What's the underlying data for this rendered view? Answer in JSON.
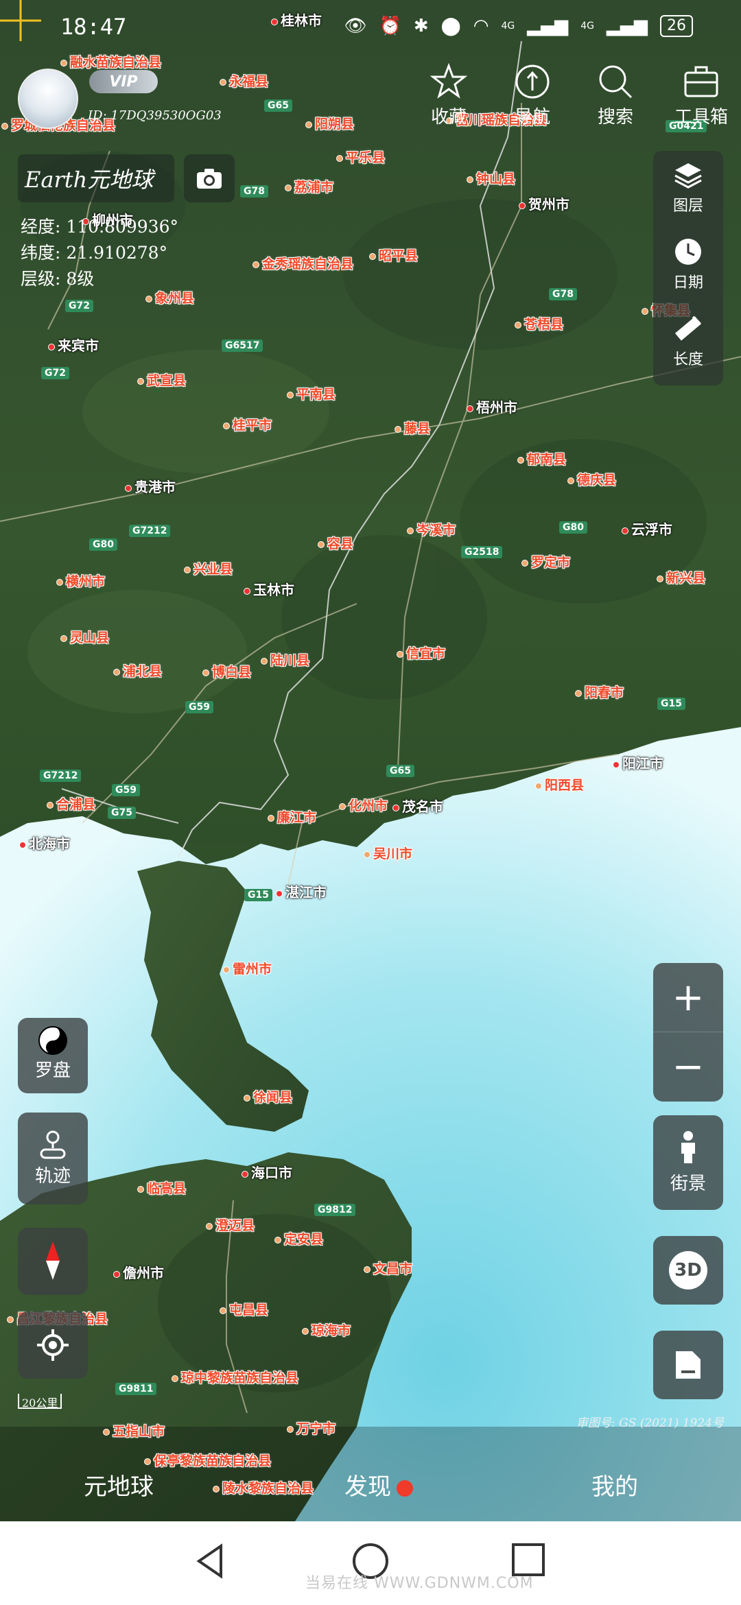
{
  "status_bar": {
    "time": "18:47",
    "network_1": "4G",
    "network_2": "4G",
    "battery": "26"
  },
  "user": {
    "vip_label": "VIP",
    "id": "ID: 17DQ39530OG03"
  },
  "brand": {
    "title": "Earth元地球"
  },
  "coordinates": {
    "longitude": "经度: 110.809936°",
    "latitude": "纬度: 21.910278°",
    "level": "层级: 8级"
  },
  "top_actions": [
    {
      "label": "收藏",
      "icon": "star-icon"
    },
    {
      "label": "导航",
      "icon": "navigation-icon"
    },
    {
      "label": "搜索",
      "icon": "search-icon"
    },
    {
      "label": "工具箱",
      "icon": "toolbox-icon"
    }
  ],
  "tool_panel": [
    {
      "label": "图层",
      "icon": "layers-icon"
    },
    {
      "label": "日期",
      "icon": "clock-icon"
    },
    {
      "label": "长度",
      "icon": "ruler-icon"
    }
  ],
  "left_controls": {
    "compass": "罗盘",
    "track": "轨迹"
  },
  "right_controls": {
    "zoom_in": "+",
    "zoom_out": "−",
    "street_view": "街景",
    "three_d": "3D"
  },
  "scale_bar": "20公里",
  "map_approval": "审图号: GS (2021) 1924号",
  "places": [
    {
      "name": "融水苗族自治县",
      "type": "county"
    },
    {
      "name": "罗城仫佬族自治县",
      "type": "county"
    },
    {
      "name": "桂林市",
      "type": "city"
    },
    {
      "name": "永福县",
      "type": "county"
    },
    {
      "name": "阳朔县",
      "type": "county"
    },
    {
      "name": "富川瑶族自治县",
      "type": "county"
    },
    {
      "name": "平乐县",
      "type": "county"
    },
    {
      "name": "荔浦市",
      "type": "county"
    },
    {
      "name": "钟山县",
      "type": "county"
    },
    {
      "name": "贺州市",
      "type": "city"
    },
    {
      "name": "柳州市",
      "type": "city"
    },
    {
      "name": "金秀瑶族自治县",
      "type": "county"
    },
    {
      "name": "昭平县",
      "type": "county"
    },
    {
      "name": "象州县",
      "type": "county"
    },
    {
      "name": "来宾市",
      "type": "city"
    },
    {
      "name": "苍梧县",
      "type": "county"
    },
    {
      "name": "怀集县",
      "type": "county"
    },
    {
      "name": "武宣县",
      "type": "county"
    },
    {
      "name": "平南县",
      "type": "county"
    },
    {
      "name": "桂平市",
      "type": "county"
    },
    {
      "name": "梧州市",
      "type": "city"
    },
    {
      "name": "藤县",
      "type": "county"
    },
    {
      "name": "贵港市",
      "type": "city"
    },
    {
      "name": "郁南县",
      "type": "county"
    },
    {
      "name": "德庆县",
      "type": "county"
    },
    {
      "name": "岑溪市",
      "type": "county"
    },
    {
      "name": "云浮市",
      "type": "city"
    },
    {
      "name": "横州市",
      "type": "county"
    },
    {
      "name": "兴业县",
      "type": "county"
    },
    {
      "name": "容县",
      "type": "county"
    },
    {
      "name": "罗定市",
      "type": "county"
    },
    {
      "name": "新兴县",
      "type": "county"
    },
    {
      "name": "玉林市",
      "type": "city"
    },
    {
      "name": "灵山县",
      "type": "county"
    },
    {
      "name": "信宜市",
      "type": "county"
    },
    {
      "name": "浦北县",
      "type": "county"
    },
    {
      "name": "博白县",
      "type": "county"
    },
    {
      "name": "陆川县",
      "type": "county"
    },
    {
      "name": "阳春市",
      "type": "county"
    },
    {
      "name": "阳江市",
      "type": "city"
    },
    {
      "name": "合浦县",
      "type": "county"
    },
    {
      "name": "廉江市",
      "type": "county"
    },
    {
      "name": "化州市",
      "type": "county"
    },
    {
      "name": "茂名市",
      "type": "city"
    },
    {
      "name": "阳西县",
      "type": "county"
    },
    {
      "name": "北海市",
      "type": "city"
    },
    {
      "name": "吴川市",
      "type": "county"
    },
    {
      "name": "湛江市",
      "type": "city"
    },
    {
      "name": "雷州市",
      "type": "county"
    },
    {
      "name": "徐闻县",
      "type": "county"
    },
    {
      "name": "海口市",
      "type": "city"
    },
    {
      "name": "临高县",
      "type": "county"
    },
    {
      "name": "澄迈县",
      "type": "county"
    },
    {
      "name": "定安县",
      "type": "county"
    },
    {
      "name": "儋州市",
      "type": "city"
    },
    {
      "name": "文昌市",
      "type": "county"
    },
    {
      "name": "屯昌县",
      "type": "county"
    },
    {
      "name": "琼海市",
      "type": "county"
    },
    {
      "name": "昌江黎族自治县",
      "type": "county"
    },
    {
      "name": "琼中黎族苗族自治县",
      "type": "county"
    },
    {
      "name": "五指山市",
      "type": "county"
    },
    {
      "name": "万宁市",
      "type": "county"
    },
    {
      "name": "保亭黎族苗族自治县",
      "type": "county"
    },
    {
      "name": "陵水黎族自治县",
      "type": "county"
    }
  ],
  "roads": [
    "G65",
    "G0421",
    "G78",
    "G72",
    "G6517",
    "G7212",
    "G80",
    "G2518",
    "G59",
    "G15",
    "G75",
    "G9812",
    "G9811"
  ],
  "bottom_tabs": [
    {
      "label": "元地球"
    },
    {
      "label": "发现",
      "has_badge": true
    },
    {
      "label": "我的"
    }
  ],
  "nav_bar": {
    "watermark": "当易在线 WWW.GDNWM.COM"
  },
  "colors": {
    "place_label": "#f04a2a",
    "road_badge": "#2f8b5a",
    "sea_light": "#bfeef4",
    "sea_deep": "#7fd6e6",
    "panel_bg": "rgba(60,65,65,0.8)"
  }
}
